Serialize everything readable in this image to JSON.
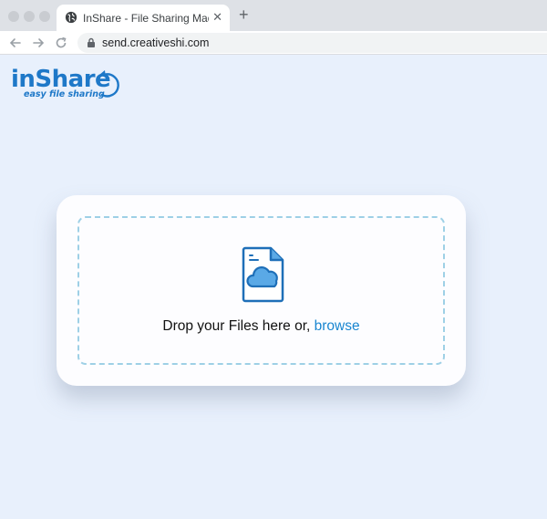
{
  "browser": {
    "tab_title": "InShare - File Sharing Made Easy",
    "tab_close": "✕",
    "new_tab": "+",
    "url": "send.creativeshi.com"
  },
  "logo": {
    "main": "inShare",
    "tagline": "easy file sharing"
  },
  "upload": {
    "prompt": "Drop your Files here or, ",
    "browse_label": "browse"
  },
  "colors": {
    "accent": "#1e78c8",
    "page_background": "#e8f0fc",
    "dropzone_border": "#9ed0e6",
    "cloud_fill": "#5aa9e6"
  }
}
